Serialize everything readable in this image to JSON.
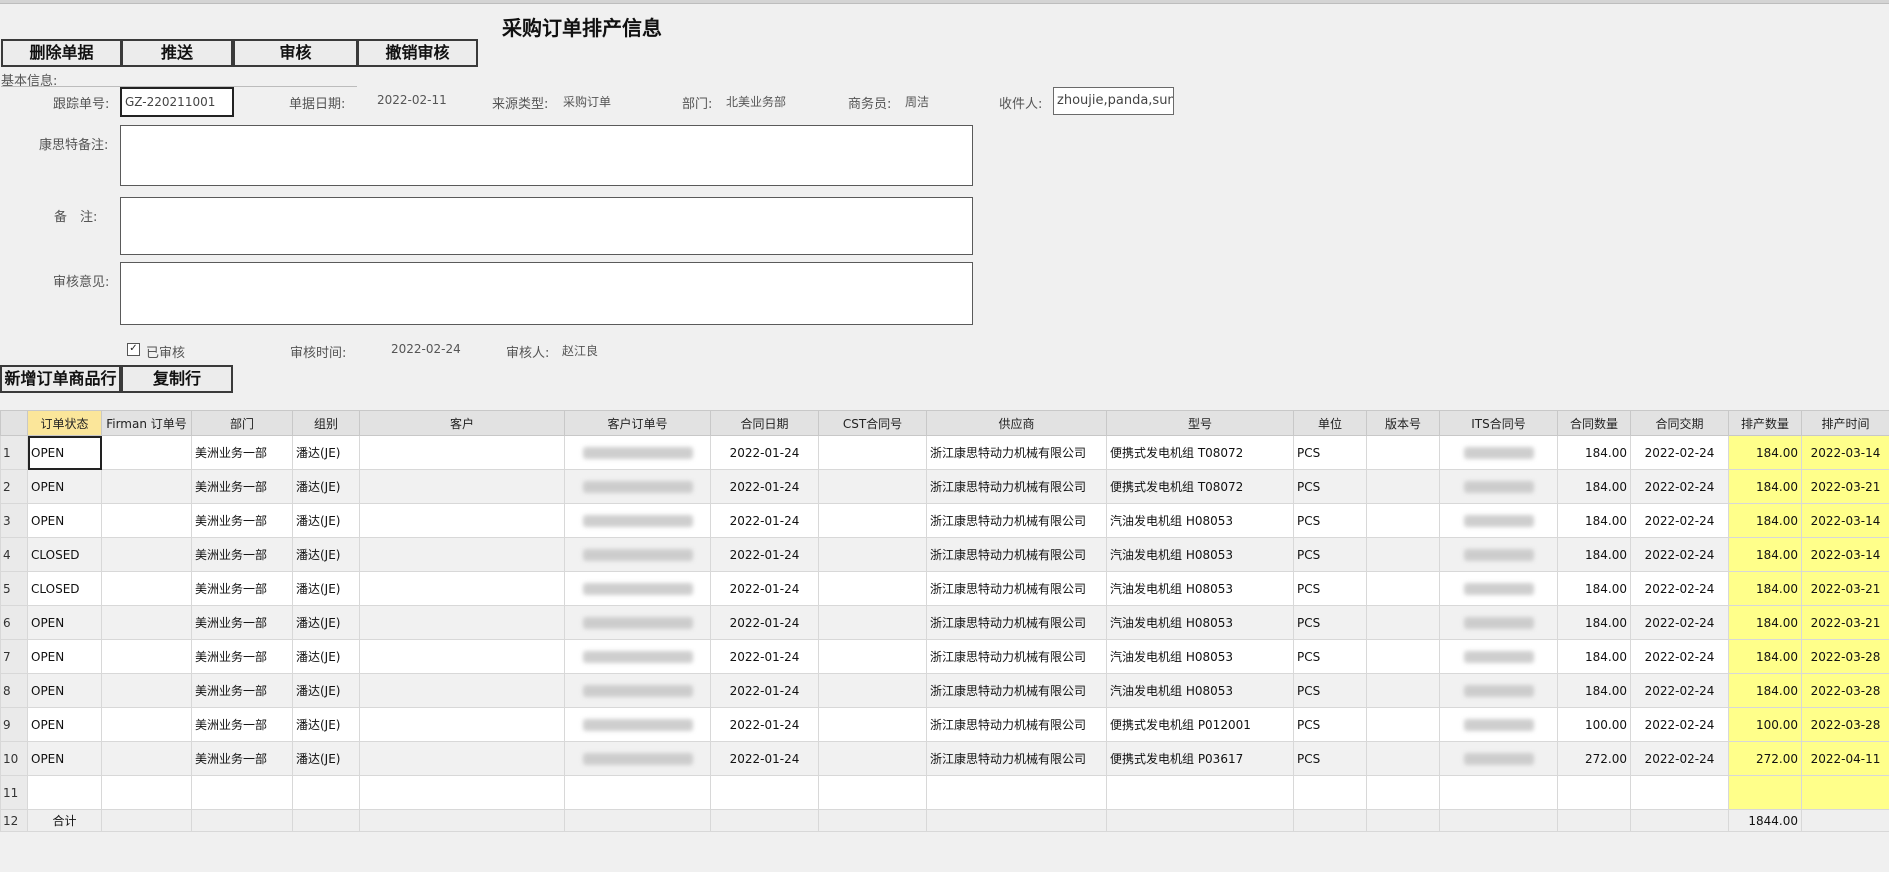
{
  "title": "采购订单排产信息",
  "toolbar": {
    "delete_label": "删除单据",
    "push_label": "推送",
    "audit_label": "审核",
    "unaudit_label": "撤销审核"
  },
  "basic_info_label": "基本信息:",
  "form": {
    "tracking_no_label": "跟踪单号:",
    "tracking_no_value": "GZ-220211001",
    "doc_date_label": "单据日期:",
    "doc_date_value": "2022-02-11",
    "source_type_label": "来源类型:",
    "source_type_value": "采购订单",
    "dept_label": "部门:",
    "dept_value": "北美业务部",
    "sales_label": "商务员:",
    "sales_value": "周洁",
    "receiver_label": "收件人:",
    "receiver_value": "zhoujie,panda,sunx",
    "cst_remark_label": "康思特备注:",
    "remark_label": "备　注:",
    "audit_opinion_label": "审核意见:",
    "audited_label": "已审核",
    "audit_time_label": "审核时间:",
    "audit_time_value": "2022-02-24",
    "auditor_label": "审核人:",
    "auditor_value": "赵江良"
  },
  "row_buttons": {
    "add_row_label": "新增订单商品行",
    "copy_row_label": "复制行"
  },
  "grid": {
    "columns": [
      "订单状态",
      "Firman 订单号",
      "部门",
      "组别",
      "客户",
      "客户订单号",
      "合同日期",
      "CST合同号",
      "供应商",
      "型号",
      "单位",
      "版本号",
      "ITS合同号",
      "合同数量",
      "合同交期",
      "排产数量",
      "排产时间"
    ],
    "rows": [
      {
        "no": "1",
        "status": "OPEN",
        "dept": "美洲业务一部",
        "group": "潘达(JE)",
        "contract_date": "2022-01-24",
        "supplier": "浙江康思特动力机械有限公司",
        "model": "便携式发电机组 T08072",
        "unit": "PCS",
        "qty": "184.00",
        "delivery": "2022-02-24",
        "plan_qty": "184.00",
        "plan_time": "2022-03-14"
      },
      {
        "no": "2",
        "status": "OPEN",
        "dept": "美洲业务一部",
        "group": "潘达(JE)",
        "contract_date": "2022-01-24",
        "supplier": "浙江康思特动力机械有限公司",
        "model": "便携式发电机组 T08072",
        "unit": "PCS",
        "qty": "184.00",
        "delivery": "2022-02-24",
        "plan_qty": "184.00",
        "plan_time": "2022-03-21"
      },
      {
        "no": "3",
        "status": "OPEN",
        "dept": "美洲业务一部",
        "group": "潘达(JE)",
        "contract_date": "2022-01-24",
        "supplier": "浙江康思特动力机械有限公司",
        "model": "汽油发电机组 H08053",
        "unit": "PCS",
        "qty": "184.00",
        "delivery": "2022-02-24",
        "plan_qty": "184.00",
        "plan_time": "2022-03-14"
      },
      {
        "no": "4",
        "status": "CLOSED",
        "dept": "美洲业务一部",
        "group": "潘达(JE)",
        "contract_date": "2022-01-24",
        "supplier": "浙江康思特动力机械有限公司",
        "model": "汽油发电机组 H08053",
        "unit": "PCS",
        "qty": "184.00",
        "delivery": "2022-02-24",
        "plan_qty": "184.00",
        "plan_time": "2022-03-14"
      },
      {
        "no": "5",
        "status": "CLOSED",
        "dept": "美洲业务一部",
        "group": "潘达(JE)",
        "contract_date": "2022-01-24",
        "supplier": "浙江康思特动力机械有限公司",
        "model": "汽油发电机组 H08053",
        "unit": "PCS",
        "qty": "184.00",
        "delivery": "2022-02-24",
        "plan_qty": "184.00",
        "plan_time": "2022-03-21"
      },
      {
        "no": "6",
        "status": "OPEN",
        "dept": "美洲业务一部",
        "group": "潘达(JE)",
        "contract_date": "2022-01-24",
        "supplier": "浙江康思特动力机械有限公司",
        "model": "汽油发电机组 H08053",
        "unit": "PCS",
        "qty": "184.00",
        "delivery": "2022-02-24",
        "plan_qty": "184.00",
        "plan_time": "2022-03-21"
      },
      {
        "no": "7",
        "status": "OPEN",
        "dept": "美洲业务一部",
        "group": "潘达(JE)",
        "contract_date": "2022-01-24",
        "supplier": "浙江康思特动力机械有限公司",
        "model": "汽油发电机组 H08053",
        "unit": "PCS",
        "qty": "184.00",
        "delivery": "2022-02-24",
        "plan_qty": "184.00",
        "plan_time": "2022-03-28"
      },
      {
        "no": "8",
        "status": "OPEN",
        "dept": "美洲业务一部",
        "group": "潘达(JE)",
        "contract_date": "2022-01-24",
        "supplier": "浙江康思特动力机械有限公司",
        "model": "汽油发电机组 H08053",
        "unit": "PCS",
        "qty": "184.00",
        "delivery": "2022-02-24",
        "plan_qty": "184.00",
        "plan_time": "2022-03-28"
      },
      {
        "no": "9",
        "status": "OPEN",
        "dept": "美洲业务一部",
        "group": "潘达(JE)",
        "contract_date": "2022-01-24",
        "supplier": "浙江康思特动力机械有限公司",
        "model": "便携式发电机组 P012001",
        "unit": "PCS",
        "qty": "100.00",
        "delivery": "2022-02-24",
        "plan_qty": "100.00",
        "plan_time": "2022-03-28"
      },
      {
        "no": "10",
        "status": "OPEN",
        "dept": "美洲业务一部",
        "group": "潘达(JE)",
        "contract_date": "2022-01-24",
        "supplier": "浙江康思特动力机械有限公司",
        "model": "便携式发电机组 P03617",
        "unit": "PCS",
        "qty": "272.00",
        "delivery": "2022-02-24",
        "plan_qty": "272.00",
        "plan_time": "2022-04-11"
      }
    ],
    "empty_row_no": "11",
    "total_row_no": "12",
    "total_label": "合计",
    "total_plan_qty": "1844.00"
  },
  "colors": {
    "status_header": "#fbe69a",
    "plan_highlight": "#ffff8a",
    "background": "#f0f0f0"
  }
}
